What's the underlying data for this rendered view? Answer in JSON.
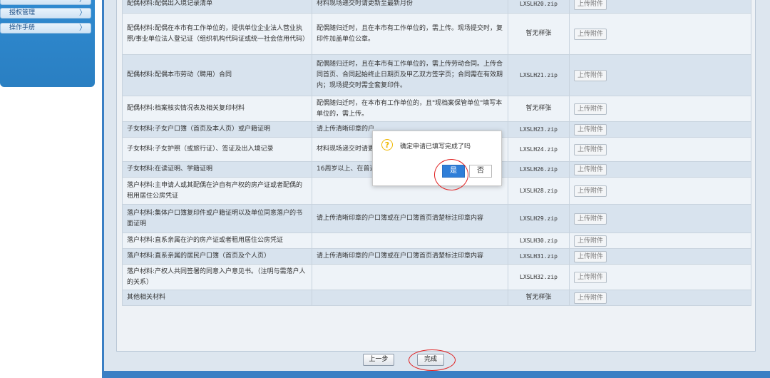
{
  "sidebar": {
    "items": [
      {
        "label": "授权管理"
      },
      {
        "label": "操作手册"
      }
    ]
  },
  "table": {
    "rows": [
      {
        "material": "配偶材料:配偶出入境记录清单",
        "note": "材料现场递交时请更新至最新月份",
        "sample": "LXSLH20.zip",
        "mono": true,
        "upload": "上传附件"
      },
      {
        "material": "配偶材料:配偶在本市有工作单位的，提供单位企业法人营业执照/事业单位法人登记证（组织机构代码证或统一社会信用代码）",
        "note": "配偶随归迁时，且在本市有工作单位的，需上传。现场提交时，复印件加盖单位公章。",
        "sample": "暂无样张",
        "mono": false,
        "upload": "上传附件"
      },
      {
        "material": "配偶材料:配偶本市劳动（聘用）合同",
        "note": "配偶随归迁时，且在本市有工作单位的，需上传劳动合同。上传合同首页、合同起始终止日期页及甲乙双方签字页；合同需在有效期内；现场提交时需全套复印件。",
        "sample": "LXSLH21.zip",
        "mono": true,
        "upload": "上传附件"
      },
      {
        "material": "配偶材料:档案核实情况表及相关复印材料",
        "note": "配偶随归迁时，在本市有工作单位的，且\"现档案保管单位\"填写本单位的，需上传。",
        "sample": "暂无样张",
        "mono": false,
        "upload": "上传附件"
      },
      {
        "material": "子女材料:子女户口簿（首页及本人页）或户籍证明",
        "note": "请上传清晰印章的户",
        "sample": "LXSLH23.zip",
        "mono": true,
        "upload": "上传附件"
      },
      {
        "material": "子女材料:子女护照（或旅行证）、签证及出入境记录",
        "note": "材料现场递交时请更 首页复印件",
        "sample": "LXSLH24.zip",
        "mono": true,
        "upload": "上传附件"
      },
      {
        "material": "子女材料:在读证明、学籍证明",
        "note": "16周岁以上、在普通",
        "sample": "LXSLH26.zip",
        "mono": true,
        "upload": "上传附件"
      },
      {
        "material": "落户材料:主申请人或其配偶在沪自有产权的房产证或者配偶的租用居住公房凭证",
        "note": "",
        "sample": "LXSLH28.zip",
        "mono": true,
        "upload": "上传附件"
      },
      {
        "material": "落户材料:集体户口簿复印件或户籍证明以及单位同意落户的书面证明",
        "note": "请上传清晰印章的户口簿或在户口簿首页清楚标注印章内容",
        "sample": "LXSLH29.zip",
        "mono": true,
        "upload": "上传附件"
      },
      {
        "material": "落户材料:直系亲属在沪的房产证或者租用居住公房凭证",
        "note": "",
        "sample": "LXSLH30.zip",
        "mono": true,
        "upload": "上传附件"
      },
      {
        "material": "落户材料:直系亲属的居民户口簿（首页及个人页）",
        "note": "请上传清晰印章的户口簿或在户口簿首页清楚标注印章内容",
        "sample": "LXSLH31.zip",
        "mono": true,
        "upload": "上传附件"
      },
      {
        "material": "落户材料:产权人共同签署的同意入户意见书。（注明与需落户人的关系）",
        "note": "",
        "sample": "LXSLH32.zip",
        "mono": true,
        "upload": "上传附件"
      },
      {
        "material": "其他相关材料",
        "note": "",
        "sample": "暂无样张",
        "mono": false,
        "upload": "上传附件"
      }
    ]
  },
  "footer": {
    "prev_label": "上一步",
    "finish_label": "完成"
  },
  "dialog": {
    "icon": "question-icon",
    "message": "确定申请已填写完成了吗",
    "yes_label": "是",
    "no_label": "否"
  },
  "colors": {
    "accent": "#2f7ed8",
    "sidebar": "#2a7fc2",
    "highlight_ring": "#e02020"
  }
}
